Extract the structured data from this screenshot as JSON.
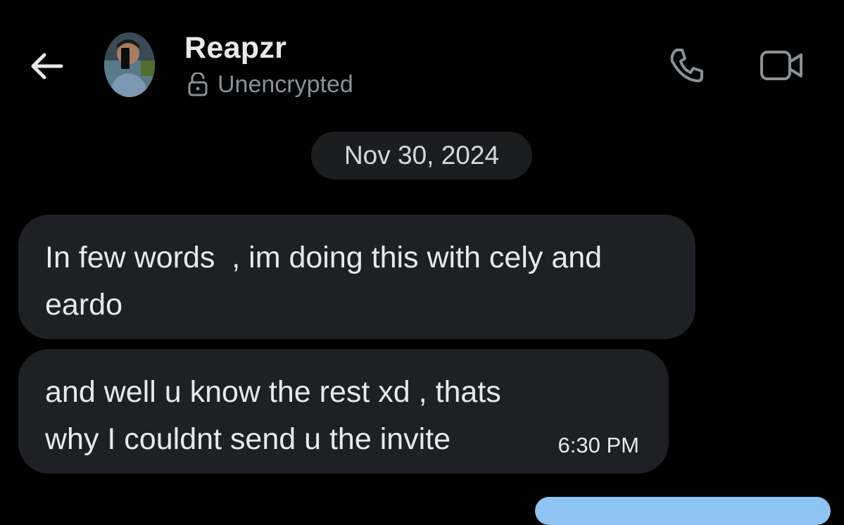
{
  "header": {
    "contact_name": "Reapzr",
    "encryption_status": "Unencrypted",
    "icons": {
      "back": "back-arrow-icon",
      "lock": "unlocked-icon",
      "call": "phone-icon",
      "video": "video-camera-icon"
    }
  },
  "conversation": {
    "date_separator": "Nov 30, 2024",
    "messages": [
      {
        "text": "In few words  , im doing this with cely and eardo"
      },
      {
        "text": "and well u know the rest xd , thats why I couldnt send u the invite",
        "time": "6:30 PM"
      }
    ]
  },
  "colors": {
    "background": "#000000",
    "bubble": "#1f2023",
    "date_pill": "#1c1d1f",
    "muted_text": "#8b9095",
    "primary_text": "#e7e9ea",
    "outgoing_bubble": "#8ec3f2"
  }
}
